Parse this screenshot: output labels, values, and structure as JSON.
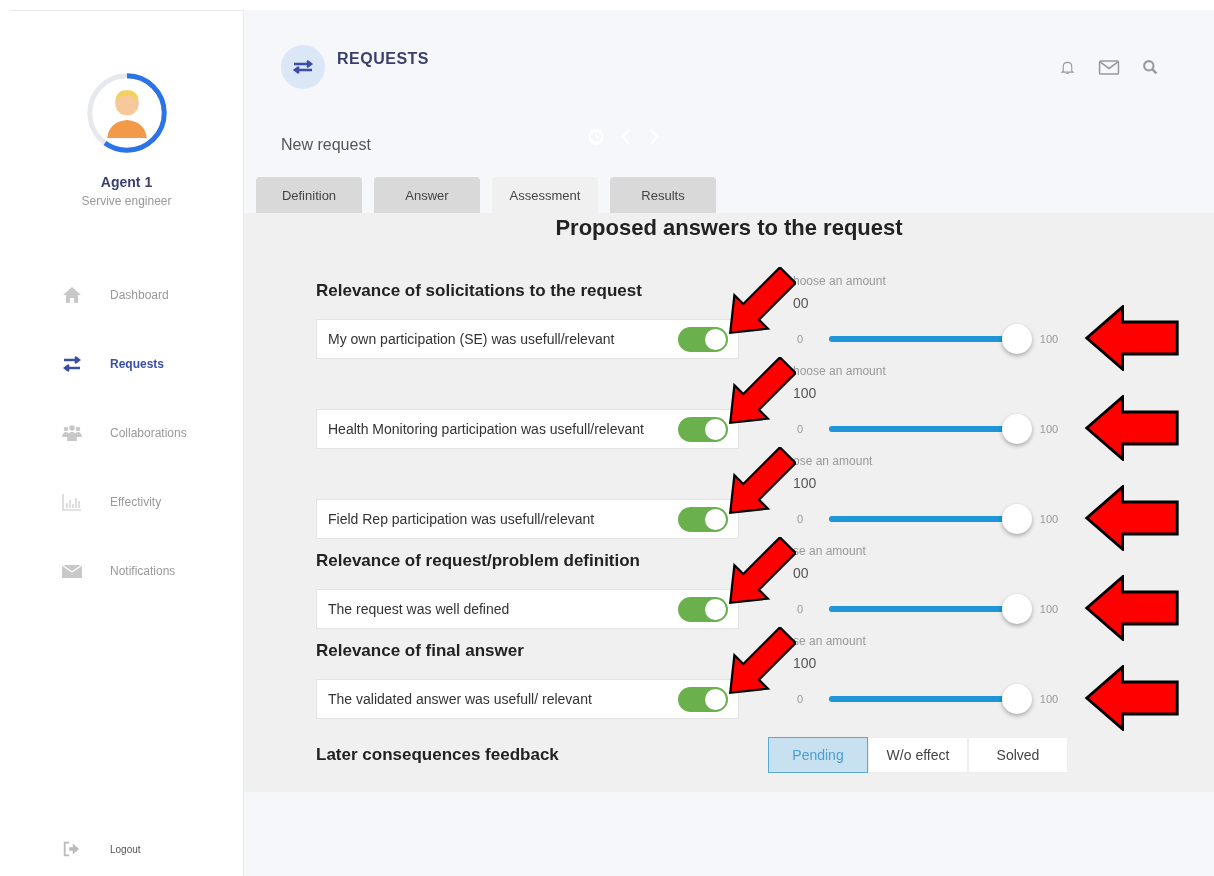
{
  "sidebar": {
    "profile": {
      "name": "Agent 1",
      "role": "Servive engineer"
    },
    "nav": [
      {
        "label": "Dashboard",
        "kind": "home",
        "selected": false
      },
      {
        "label": "Requests",
        "kind": "swap",
        "selected": true
      },
      {
        "label": "Collaborations",
        "kind": "people",
        "selected": false
      },
      {
        "label": "Effectivity",
        "kind": "chart",
        "selected": false
      },
      {
        "label": "Notifications",
        "kind": "mail",
        "selected": false
      }
    ],
    "logout": "Logout"
  },
  "header": {
    "title": "REQUESTS",
    "subtitle": "New request"
  },
  "tabs": [
    {
      "label": "Definition",
      "selected": false
    },
    {
      "label": "Answer",
      "selected": false
    },
    {
      "label": "Assessment",
      "selected": true
    },
    {
      "label": "Results",
      "selected": false
    }
  ],
  "panel": {
    "title": "Proposed answers to the request",
    "sections": [
      {
        "title": "Relevance of solicitations to the request",
        "items": [
          {
            "label": "My own participation (SE) was usefull/relevant",
            "on": true,
            "caption": "hoose an amount",
            "value": "00",
            "min": "0",
            "max": "100",
            "level": 1
          },
          {
            "label": "Health Monitoring participation was usefull/relevant",
            "on": true,
            "caption": "hoose an amount",
            "value": "100",
            "min": "0",
            "max": "100",
            "level": 1
          },
          {
            "label": "Field Rep participation was usefull/relevant",
            "on": true,
            "caption": "ose an amount",
            "value": "100",
            "min": "0",
            "max": "100",
            "level": 1
          }
        ]
      },
      {
        "title": "Relevance of request/problem definition",
        "items": [
          {
            "label": "The request was well defined",
            "on": true,
            "caption": "se an amount",
            "value": "00",
            "min": "0",
            "max": "100",
            "level": 1
          }
        ]
      },
      {
        "title": "Relevance of final answer",
        "items": [
          {
            "label": "The validated answer was usefull/ relevant",
            "on": true,
            "caption": "se an amount",
            "value": "100",
            "min": "0",
            "max": "100",
            "level": 1
          }
        ]
      }
    ],
    "feedback": {
      "label": "Later consequences feedback",
      "options": [
        {
          "label": "Pending",
          "selected": true
        },
        {
          "label": "W/o effect",
          "selected": false
        },
        {
          "label": "Solved",
          "selected": false
        }
      ]
    }
  }
}
